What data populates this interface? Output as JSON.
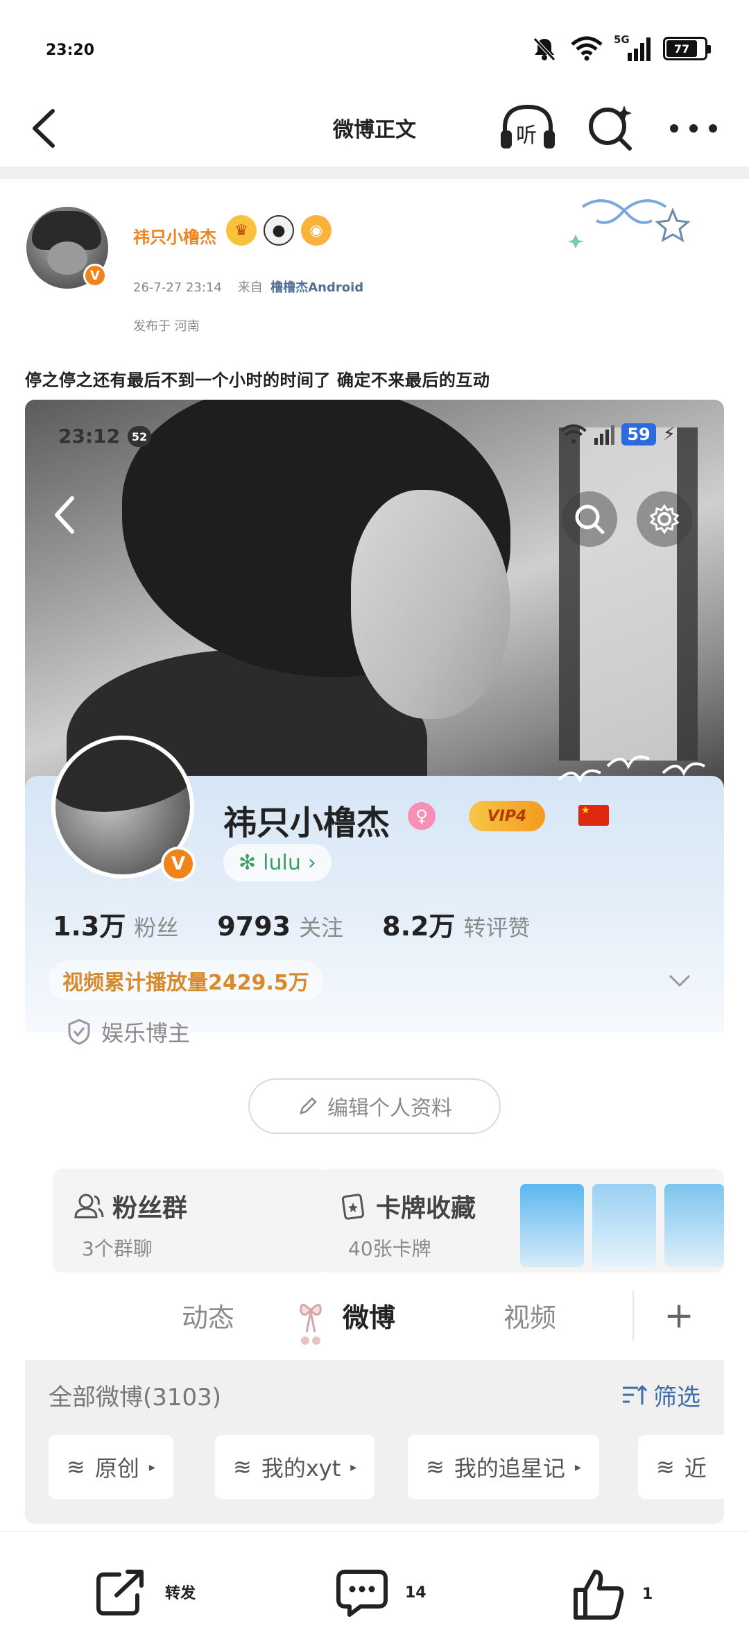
{
  "status_bar": {
    "time": "23:20",
    "network": "5G",
    "battery": "77"
  },
  "navbar": {
    "title": "微博正文",
    "listen_label": "听"
  },
  "post": {
    "username": "祎只小橹杰",
    "timestamp": "26-7-27 23:14",
    "source_prefix": "来自",
    "source": "橹橹杰Android",
    "location": "发布于 河南",
    "text": "停之停之还有最后不到一个小时的时间了 确定不来最后的互动"
  },
  "screenshot": {
    "status_time": "23:12",
    "status_badge": "52",
    "battery": "59",
    "profile": {
      "name": "祎只小橹杰",
      "vip": "VIP4",
      "tag": "lulu",
      "stats": [
        {
          "num": "1.3万",
          "label": "粉丝"
        },
        {
          "num": "9793",
          "label": "关注"
        },
        {
          "num": "8.2万",
          "label": "转评赞"
        }
      ],
      "play_count": "视频累计播放量2429.5万",
      "category": "娱乐博主",
      "edit_button": "编辑个人资料"
    },
    "cards": {
      "fans": {
        "title": "粉丝群",
        "sub": "3个群聊"
      },
      "collect": {
        "title": "卡牌收藏",
        "sub": "40张卡牌"
      }
    },
    "tabs": [
      "动态",
      "微博",
      "视频"
    ],
    "filter": {
      "title": "全部微博(3103)",
      "filter_label": "筛选",
      "chips": [
        "原创",
        "我的xyt",
        "我的追星记",
        "近"
      ]
    }
  },
  "actions": {
    "repost": "转发",
    "comment": "14",
    "like": "1"
  }
}
